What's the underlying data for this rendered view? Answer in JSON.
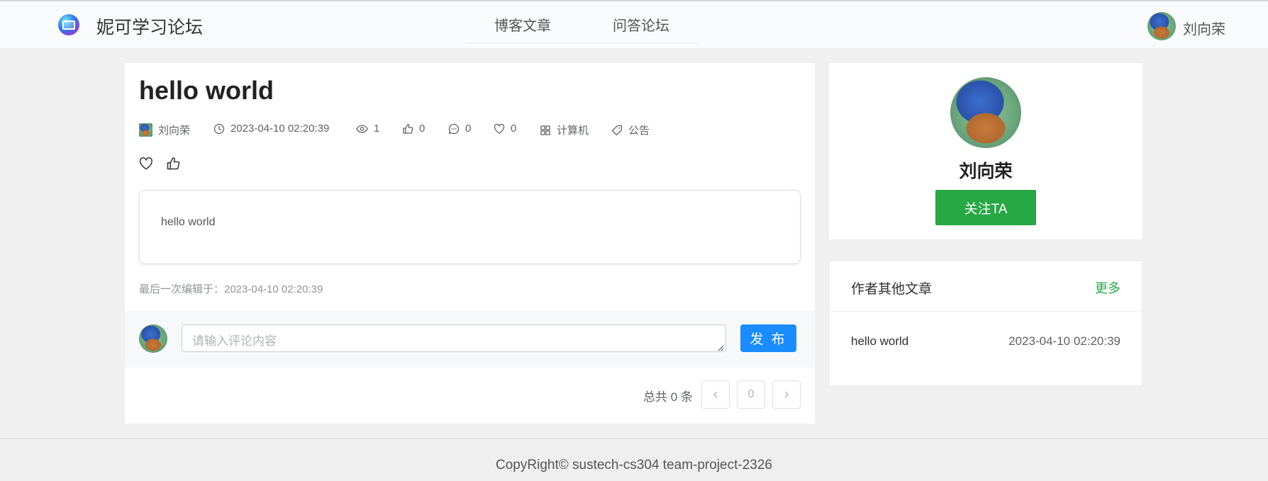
{
  "header": {
    "site_title": "妮可学习论坛",
    "nav": [
      {
        "label": "博客文章"
      },
      {
        "label": "问答论坛"
      }
    ],
    "user_name": "刘向荣"
  },
  "article": {
    "title": "hello world",
    "meta": {
      "author": "刘向荣",
      "datetime": "2023-04-10 02:20:39",
      "views": "1",
      "likes": "0",
      "comments": "0",
      "favorites": "0",
      "category": "计算机",
      "tag": "公告"
    },
    "content": "hello world",
    "last_edited": "最后一次编辑于：2023-04-10 02:20:39"
  },
  "comment": {
    "placeholder": "请输入评论内容",
    "value": "",
    "publish_label": "发 布"
  },
  "pagination": {
    "total_text": "总共 0 条",
    "current_page": "0"
  },
  "author_card": {
    "name": "刘向荣",
    "follow_label": "关注TA"
  },
  "other_articles": {
    "title": "作者其他文章",
    "more_label": "更多",
    "items": [
      {
        "title": "hello world",
        "date": "2023-04-10 02:20:39"
      }
    ]
  },
  "footer": {
    "copyright": "CopyRight© sustech-cs304 team-project-2326"
  },
  "colors": {
    "primary": "#1a8cff",
    "success": "#28a745",
    "page_bg": "#f0f0f0"
  },
  "icons": [
    "forum-logo-icon",
    "clock-icon",
    "eye-icon",
    "thumb-up-icon",
    "comment-icon",
    "heart-icon",
    "grid-icon",
    "tag-icon",
    "chevron-left-icon",
    "chevron-right-icon"
  ]
}
